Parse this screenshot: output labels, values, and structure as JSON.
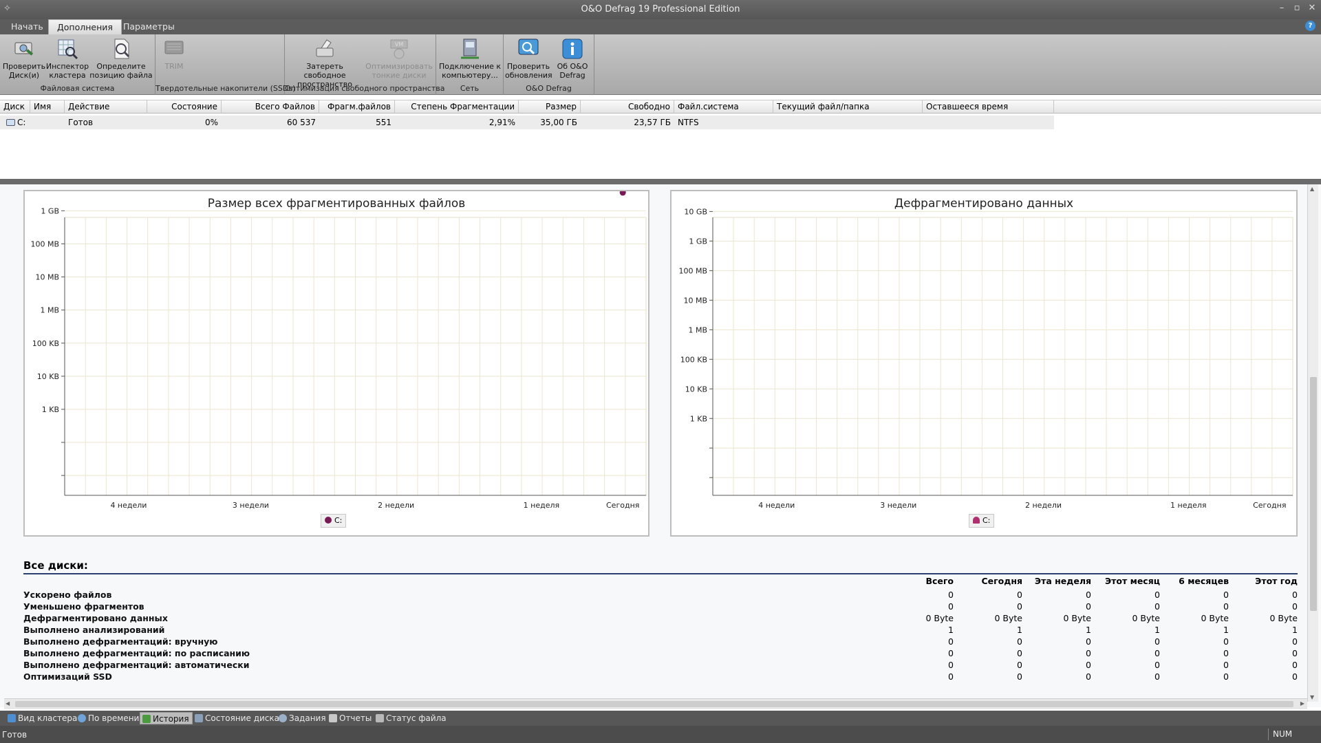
{
  "window": {
    "title": "O&O Defrag 19 Professional Edition"
  },
  "tabs": [
    {
      "label": "Начать"
    },
    {
      "label": "Дополнения"
    },
    {
      "label": "Параметры"
    }
  ],
  "ribbon": {
    "groups": [
      {
        "label": "Файловая система",
        "buttons": [
          {
            "label": "Проверить\nДиск(и)",
            "icon": "check-disk-icon"
          },
          {
            "label": "Инспектор\nкластера",
            "icon": "cluster-inspector-icon"
          },
          {
            "label": "Определите\nпозицию файла",
            "icon": "file-position-icon"
          }
        ]
      },
      {
        "label": "Твердотельные накопители (SSDs)",
        "buttons": [
          {
            "label": "TRIM",
            "icon": "trim-icon"
          }
        ]
      },
      {
        "label": "Оптимизация свободного пространства",
        "buttons": [
          {
            "label": "Затереть свободное\nпространство",
            "icon": "wipe-free-space-icon"
          },
          {
            "label": "Оптимизировать\nтонкие диски",
            "icon": "thin-disk-icon"
          }
        ]
      },
      {
        "label": "Сеть",
        "buttons": [
          {
            "label": "Подключение к\nкомпьютеру...",
            "icon": "network-computer-icon"
          }
        ]
      },
      {
        "label": "O&O Defrag",
        "buttons": [
          {
            "label": "Проверить\nобновления",
            "icon": "check-updates-icon"
          },
          {
            "label": "Об O&O\nDefrag",
            "icon": "info-icon"
          }
        ]
      }
    ]
  },
  "drive_table": {
    "columns": [
      "Диск",
      "Имя",
      "Действие",
      "Состояние",
      "Всего Файлов",
      "Фрагм.файлов",
      "Степень Фрагментации",
      "Размер",
      "Свободно",
      "Файл.система",
      "Текущий файл/папка",
      "Оставшееся время"
    ],
    "rows": [
      {
        "disk": "C:",
        "name": "",
        "action": "Готов",
        "state": "0%",
        "total_files": "60 537",
        "frag_files": "551",
        "frag_degree": "2,91%",
        "size": "35,00 ГБ",
        "free": "23,57 ГБ",
        "fs": "NTFS",
        "current": "",
        "remaining": ""
      }
    ]
  },
  "chart_data": [
    {
      "type": "scatter",
      "title": "Размер всех фрагментированных файлов",
      "y_ticks": [
        "",
        "",
        "1 KB",
        "10 KB",
        "100 KB",
        "1 MB",
        "10 MB",
        "100 MB",
        "1 GB"
      ],
      "x_ticks": [
        "4 недели",
        "3 недели",
        "2 недели",
        "1 неделя",
        "Сегодня"
      ],
      "x_tick_pos": [
        0.11,
        0.32,
        0.57,
        0.82,
        0.96
      ],
      "log_scale": true,
      "grid": true,
      "series": [
        {
          "name": "C:",
          "color": "#7a1a55",
          "points": [
            {
              "x": "Сегодня",
              "y_log": 9.55
            }
          ]
        }
      ],
      "legend": "bottom-center"
    },
    {
      "type": "scatter",
      "title": "Дефрагментировано данных",
      "y_ticks": [
        "",
        "",
        "1 KB",
        "10 KB",
        "100 KB",
        "1 MB",
        "10 MB",
        "100 MB",
        "1 GB",
        "10 GB"
      ],
      "x_ticks": [
        "4 недели",
        "3 недели",
        "2 недели",
        "1 неделя",
        "Сегодня"
      ],
      "x_tick_pos": [
        0.11,
        0.32,
        0.57,
        0.82,
        0.96
      ],
      "log_scale": true,
      "grid": true,
      "series": [
        {
          "name": "C:",
          "color": "#b0306f",
          "points": []
        }
      ],
      "legend": "bottom-center"
    }
  ],
  "stats": {
    "header": "Все диски:",
    "columns": [
      "Всего",
      "Сегодня",
      "Эта неделя",
      "Этот месяц",
      "6 месяцев",
      "Этот год"
    ],
    "rows": [
      {
        "label": "Ускорено файлов",
        "values": [
          "0",
          "0",
          "0",
          "0",
          "0",
          "0"
        ]
      },
      {
        "label": "Уменьшено фрагментов",
        "values": [
          "0",
          "0",
          "0",
          "0",
          "0",
          "0"
        ]
      },
      {
        "label": "Дефрагментировано данных",
        "values": [
          "0 Byte",
          "0 Byte",
          "0 Byte",
          "0 Byte",
          "0 Byte",
          "0 Byte"
        ]
      },
      {
        "label": "Выполнено анализирований",
        "values": [
          "1",
          "1",
          "1",
          "1",
          "1",
          "1"
        ]
      },
      {
        "label": "Выполнено дефрагментаций: вручную",
        "values": [
          "0",
          "0",
          "0",
          "0",
          "0",
          "0"
        ]
      },
      {
        "label": "Выполнено дефрагментаций: по расписанию",
        "values": [
          "0",
          "0",
          "0",
          "0",
          "0",
          "0"
        ]
      },
      {
        "label": "Выполнено дефрагментаций: автоматически",
        "values": [
          "0",
          "0",
          "0",
          "0",
          "0",
          "0"
        ]
      },
      {
        "label": "Оптимизаций SSD",
        "values": [
          "0",
          "0",
          "0",
          "0",
          "0",
          "0"
        ]
      }
    ]
  },
  "bottom_tabs": [
    {
      "label": "Вид кластера",
      "active": false
    },
    {
      "label": "По времени",
      "active": false
    },
    {
      "label": "История",
      "active": true
    },
    {
      "label": "Состояние диска",
      "active": false
    },
    {
      "label": "Задания",
      "active": false
    },
    {
      "label": "Отчеты",
      "active": false
    },
    {
      "label": "Статус файла",
      "active": false
    }
  ],
  "statusbar": {
    "status": "Готов",
    "num": "NUM"
  }
}
